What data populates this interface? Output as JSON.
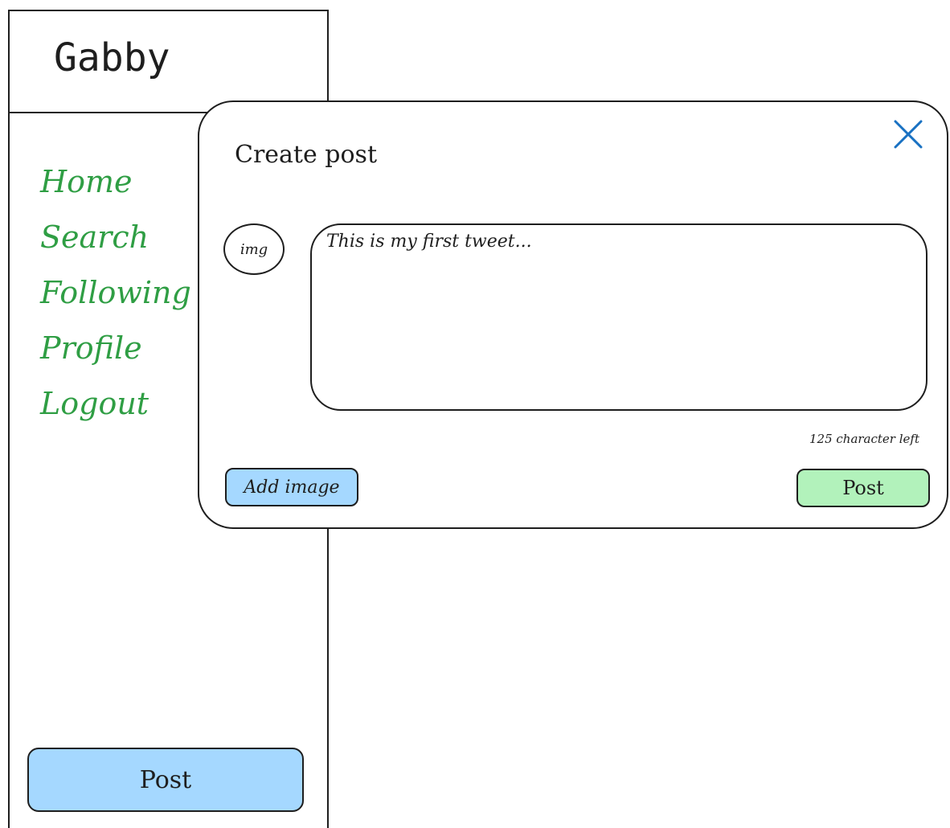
{
  "sidebar": {
    "brand": "Gabby",
    "nav": [
      "Home",
      "Search",
      "Following",
      "Profile",
      "Logout"
    ],
    "post_label": "Post"
  },
  "modal": {
    "title": "Create post",
    "close_icon": "close-icon",
    "avatar_label": "img",
    "composer_text": "This is my first tweet...",
    "char_count": "125 character left",
    "add_image_label": "Add image",
    "post_label": "Post"
  },
  "colors": {
    "nav_text": "#2f9e44",
    "blue_button": "#a5d8ff",
    "green_button": "#b2f2bb",
    "close_icon": "#1971c2"
  }
}
